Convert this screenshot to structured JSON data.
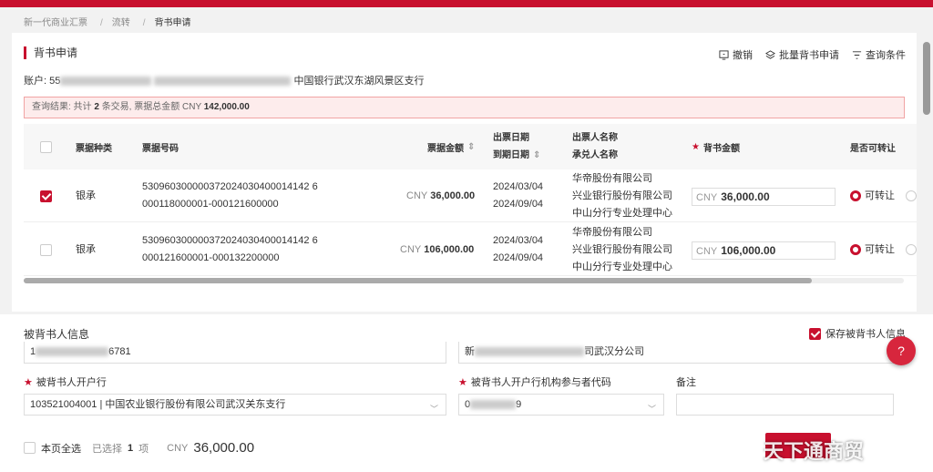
{
  "breadcrumb": [
    "新一代商业汇票",
    "流转",
    "背书申请"
  ],
  "page_title": "背书申请",
  "toolbar": {
    "revoke": "撤销",
    "batch": "批量背书申请",
    "query": "查询条件"
  },
  "account": {
    "label": "账户:",
    "prefix": "55",
    "bank": "中国银行武汉东湖风景区支行"
  },
  "result": {
    "prefix": "查询结果: 共计",
    "count": "2",
    "mid": "条交易,  票据总金额",
    "currency": "CNY",
    "total": "142,000.00"
  },
  "table": {
    "headers": {
      "type": "票据种类",
      "number": "票据号码",
      "amount": "票据金额",
      "issue_date": "出票日期",
      "due_date": "到期日期",
      "drawer": "出票人名称",
      "acceptor": "承兑人名称",
      "endorse_amount": "背书金额",
      "transferable": "是否可转让"
    },
    "rows": [
      {
        "checked": true,
        "type": "银承",
        "number1": "530960300000372024030400014142 6",
        "number2": "000118000001-000121600000",
        "currency": "CNY",
        "amount": "36,000.00",
        "issue_date": "2024/03/04",
        "due_date": "2024/09/04",
        "drawer": "华帝股份有限公司",
        "acceptor1": "兴业银行股份有限公司",
        "acceptor2": "中山分行专业处理中心",
        "endorse_currency": "CNY",
        "endorse_amount": "36,000.00",
        "transferable": "可转让"
      },
      {
        "checked": false,
        "type": "银承",
        "number1": "530960300000372024030400014142 6",
        "number2": "000121600001-000132200000",
        "currency": "CNY",
        "amount": "106,000.00",
        "issue_date": "2024/03/04",
        "due_date": "2024/09/04",
        "drawer": "华帝股份有限公司",
        "acceptor1": "兴业银行股份有限公司",
        "acceptor2": "中山分行专业处理中心",
        "endorse_currency": "CNY",
        "endorse_amount": "106,000.00",
        "transferable": "可转让"
      }
    ]
  },
  "endorsee": {
    "title": "被背书人信息",
    "save_label": "保存被背书人信息",
    "account_prefix": "1",
    "account_suffix": "6781",
    "name_prefix": "新",
    "name_suffix": "司武汉分公司",
    "bank_label": "被背书人开户行",
    "bank_value": "103521004001 | 中国农业银行股份有限公司武汉关东支行",
    "code_label": "被背书人开户行机构参与者代码",
    "code_prefix": "0",
    "code_suffix": "9",
    "remark_label": "备注"
  },
  "footer": {
    "select_all": "本页全选",
    "selected_label": "已选择",
    "selected_count": "1",
    "unit": "项",
    "currency": "CNY",
    "total": "36,000.00"
  },
  "help_label": "?",
  "watermark": "天下通商贸",
  "colors": {
    "accent": "#c8102e"
  }
}
